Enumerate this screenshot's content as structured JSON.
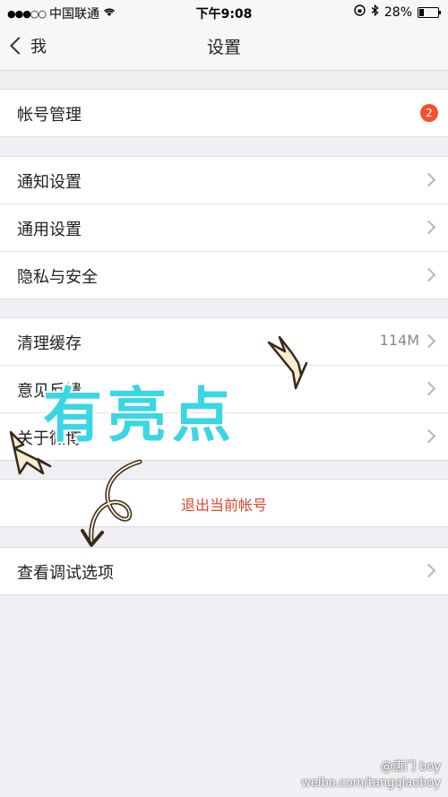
{
  "status": {
    "carrier": "中国联通",
    "time": "下午9:08",
    "battery": "28%"
  },
  "nav": {
    "back_label": "我",
    "title": "设置"
  },
  "sections": [
    {
      "items": [
        {
          "label": "帐号管理",
          "badge": "2"
        }
      ]
    },
    {
      "items": [
        {
          "label": "通知设置"
        },
        {
          "label": "通用设置"
        },
        {
          "label": "隐私与安全"
        }
      ]
    },
    {
      "items": [
        {
          "label": "清理缓存",
          "value": "114M"
        },
        {
          "label": "意见反馈"
        },
        {
          "label": "关于微博"
        }
      ]
    }
  ],
  "logout_label": "退出当前帐号",
  "debug_label": "查看调试选项",
  "overlay": {
    "text": "有亮点"
  },
  "watermark": {
    "handle": "@唐门 boy",
    "url": "weibo.com/tangqiaoboy"
  },
  "colors": {
    "accent": "#f5512c",
    "logout": "#e0442b",
    "overlay": "#3ad6e3",
    "background": "#efeff4"
  }
}
